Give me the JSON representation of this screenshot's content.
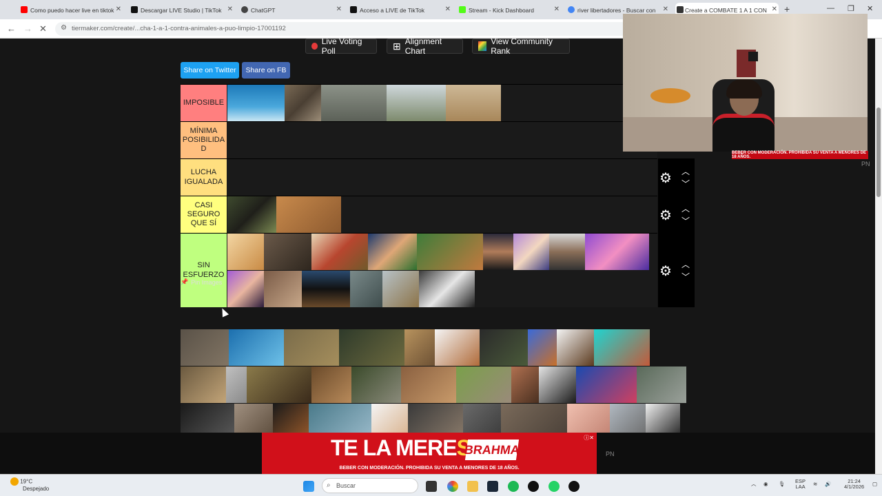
{
  "tabs": [
    {
      "label": "Como puedo hacer live en tiktok",
      "color": "#ff0000"
    },
    {
      "label": "Descargar LIVE Studio | TikTok",
      "color": "#111111"
    },
    {
      "label": "ChatGPT",
      "color": "#444444"
    },
    {
      "label": "Acceso a LIVE de TikTok",
      "color": "#111111"
    },
    {
      "label": "Stream - Kick Dashboard",
      "color": "#53fc18"
    },
    {
      "label": "river libertadores - Buscar con",
      "color": "#4285f4"
    },
    {
      "label": "Create a COMBATE 1 A 1 CON",
      "color": "#333333"
    }
  ],
  "address": {
    "url": "tiermaker.com/create/...cha-1-a-1-contra-animales-a-puo-limpio-17001192"
  },
  "top_buttons": {
    "voting": "Live Voting Poll",
    "alignment": "Alignment Chart",
    "community": "View Community Rank"
  },
  "share": {
    "twitter": "Share on Twitter",
    "fb": "Share on FB"
  },
  "tiers": [
    {
      "label": "IMPOSIBLE",
      "color": "#ff7f7f",
      "images": [
        "shark",
        "wolf",
        "wolf-pack",
        "condor",
        "giraffe"
      ]
    },
    {
      "label": "MÍNIMA POSIBILIDA D",
      "color": "#ffbf7f",
      "images": []
    },
    {
      "label": "LUCHA IGUALADA",
      "color": "#ffdf7f",
      "images": []
    },
    {
      "label": "CASI SEGURO QUE SÍ",
      "color": "#ffff7f",
      "images": [
        "chimpanzee",
        "cat"
      ]
    },
    {
      "label": "SIN ESFUERZO",
      "color": "#bfff7f",
      "images": [
        "hamster",
        "centipede",
        "rooster",
        "boy-meme",
        "proboscis-monkey",
        "gamer-man",
        "anime-girl",
        "man-waving",
        "majin-buu",
        "woman-purple",
        "owl-stump",
        "bats",
        "shoebill",
        "pelican",
        "skunk"
      ]
    }
  ],
  "pool": {
    "pin_label": "Pin Images",
    "images": [
      "hippo",
      "dolphin",
      "warthog",
      "stonefish",
      "cougar",
      "t-rex",
      "vulture",
      "horse",
      "eagle",
      "octopus",
      "sloth",
      "heron",
      "moose",
      "beaver",
      "squirrel",
      "armadillo",
      "donkey",
      "bodybuilder",
      "black-horse",
      "squid",
      "crocodile",
      "gorilla",
      "pitbull",
      "rottweiler",
      "shark-fish",
      "kid",
      "buffalo",
      "hyena",
      "rhino",
      "pig",
      "elephant",
      "penguin"
    ]
  },
  "webcam": {
    "warning": "BEBER CON MODERACIÓN. PROHIBIDA SU VENTA A MENORES DE 18 AÑOS.",
    "pn": "PN"
  },
  "ad": {
    "headline_a": "TE LA MERE",
    "headline_b": "SED",
    "brand": "BRAHMA",
    "warning": "BEBER CON MODERACIÓN. PROHIBIDA SU VENTA A MENORES DE 18 AÑOS.",
    "pn": "PN"
  },
  "taskbar": {
    "temp": "19°C",
    "weather": "Despejado",
    "search": "Buscar",
    "lang": "ESP",
    "region": "LAA",
    "time": "21:24",
    "date": "4/1/2026"
  }
}
